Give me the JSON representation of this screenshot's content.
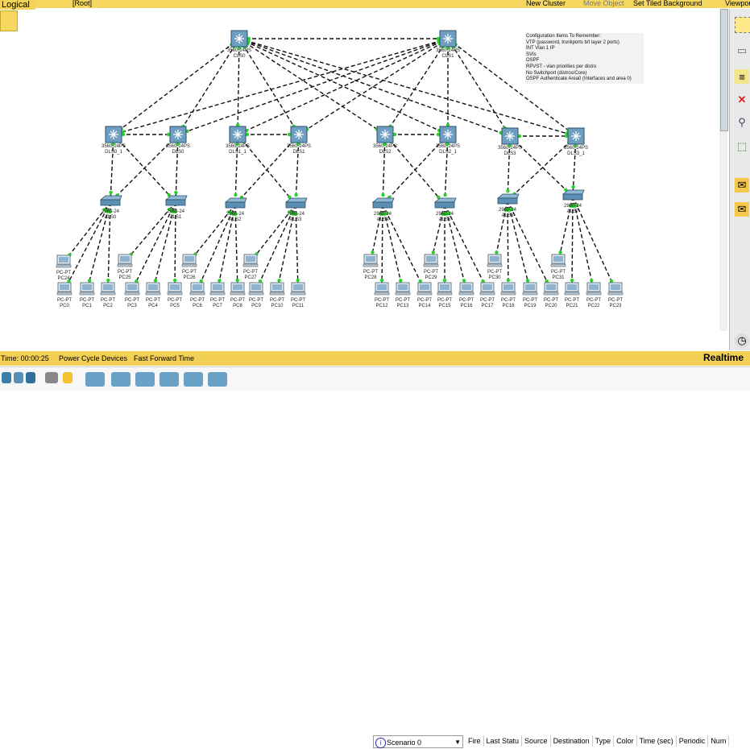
{
  "mode": "Logical",
  "root": "[Root]",
  "toolbar": {
    "new_cluster": "New Cluster",
    "move_object": "Move Object",
    "set_background": "Set Tiled Background",
    "viewport": "Viewport"
  },
  "notes": {
    "title": "Configuration Items To Remember:",
    "lines": [
      "VTP (password, trunkports b/t layer 2 ports)",
      "INT Vlan 1 IP",
      "SVIs",
      "OSPF",
      "RPVST - vlan priorities per distro",
      "No Switchport (distros/Core)",
      "OSPF Authenticate Area0 (Interfaces and area 0)"
    ]
  },
  "core": [
    {
      "model": "3560-24PS",
      "name": "CLS0"
    },
    {
      "model": "3560-24PS",
      "name": "CLS1"
    }
  ],
  "distro": [
    {
      "model": "3560-24PS",
      "name": "DLS0_1"
    },
    {
      "model": "3560-24PS",
      "name": "DLS0"
    },
    {
      "model": "3560-24PS",
      "name": "DLS1_1"
    },
    {
      "model": "3560-24PS",
      "name": "DLS1"
    },
    {
      "model": "3560-24PS",
      "name": "DLS2"
    },
    {
      "model": "3560-24PS",
      "name": "DLS2_1"
    },
    {
      "model": "3560-24PS",
      "name": "DLS3"
    },
    {
      "model": "3560-24PS",
      "name": "DLS3_1"
    }
  ],
  "access": [
    {
      "model": "2960-24",
      "name": "ALS0"
    },
    {
      "model": "2960-24",
      "name": "ALS1"
    },
    {
      "model": "2960-24",
      "name": "ALS2"
    },
    {
      "model": "2960-24",
      "name": "ALS3"
    },
    {
      "model": "2960-24",
      "name": "ALS4"
    },
    {
      "model": "2960-24",
      "name": "ALS5"
    },
    {
      "model": "2960-24",
      "name": "ALS6"
    },
    {
      "model": "2960-24",
      "name": "ALS7"
    }
  ],
  "pcs_low": [
    "PC0",
    "PC1",
    "PC2",
    "PC3",
    "PC4",
    "PC5",
    "PC6",
    "PC7",
    "PC8",
    "PC9",
    "PC10",
    "PC11",
    "PC12",
    "PC13",
    "PC14",
    "PC15",
    "PC16",
    "PC17",
    "PC18",
    "PC19",
    "PC20",
    "PC21",
    "PC22",
    "PC23"
  ],
  "pcs_high": [
    "PC24",
    "PC25",
    "PC26",
    "PC27",
    "PC28",
    "PC29",
    "PC30",
    "PC31"
  ],
  "pc_model": "PC-PT",
  "bottom": {
    "time": "Time: 00:00:25",
    "power": "Power Cycle Devices",
    "fast": "Fast Forward Time",
    "realtime": "Realtime"
  },
  "scenario": {
    "value": "Scenario 0"
  },
  "event_columns": [
    "Fire",
    "Last Statu",
    "Source",
    "Destination",
    "Type",
    "Color",
    "Time (sec)",
    "Periodic",
    "Num"
  ]
}
